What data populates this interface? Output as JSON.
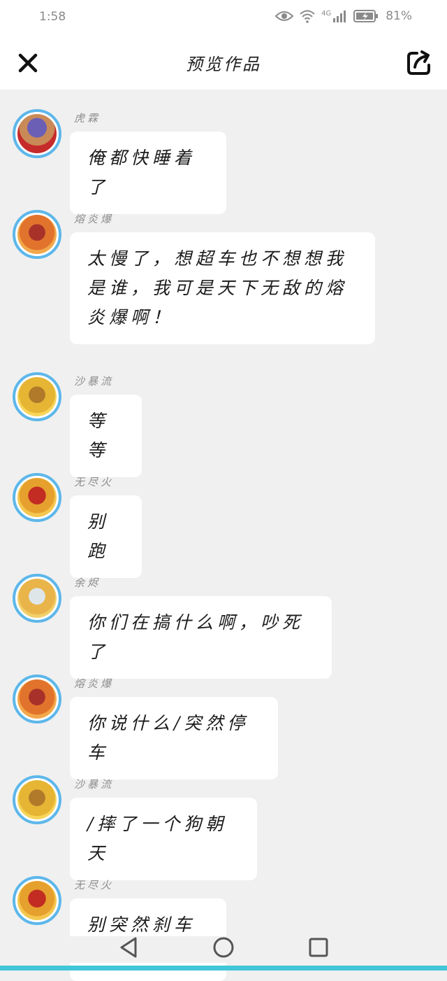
{
  "status": {
    "time": "1:58",
    "network": "4G",
    "battery": "81%"
  },
  "header": {
    "title": "预览作品"
  },
  "messages": [
    {
      "sender": "虎霖",
      "text": "俺都快睡着了"
    },
    {
      "sender": "熔炎爆",
      "text": "太慢了，想超车也不想想我是谁，我可是天下无敌的熔炎爆啊！"
    },
    {
      "sender": "沙暴流",
      "text": "等等"
    },
    {
      "sender": "无尽火",
      "text": "别跑"
    },
    {
      "sender": "余烬",
      "text": "你们在搞什么啊，吵死了"
    },
    {
      "sender": "熔炎爆",
      "text": "你说什么/突然停车"
    },
    {
      "sender": "沙暴流",
      "text": "/摔了一个狗朝天"
    },
    {
      "sender": "无尽火",
      "text": "别突然刹车呀"
    }
  ],
  "colors": {
    "avatar_ring": "#5db7ea",
    "bubble": "#ffffff",
    "background": "#f0f0f0",
    "accent_bar": "#40c6d8"
  },
  "icons": {
    "close": "close-icon",
    "share": "share-icon",
    "back": "back-triangle-icon",
    "home": "home-circle-icon",
    "recents": "recents-square-icon"
  }
}
